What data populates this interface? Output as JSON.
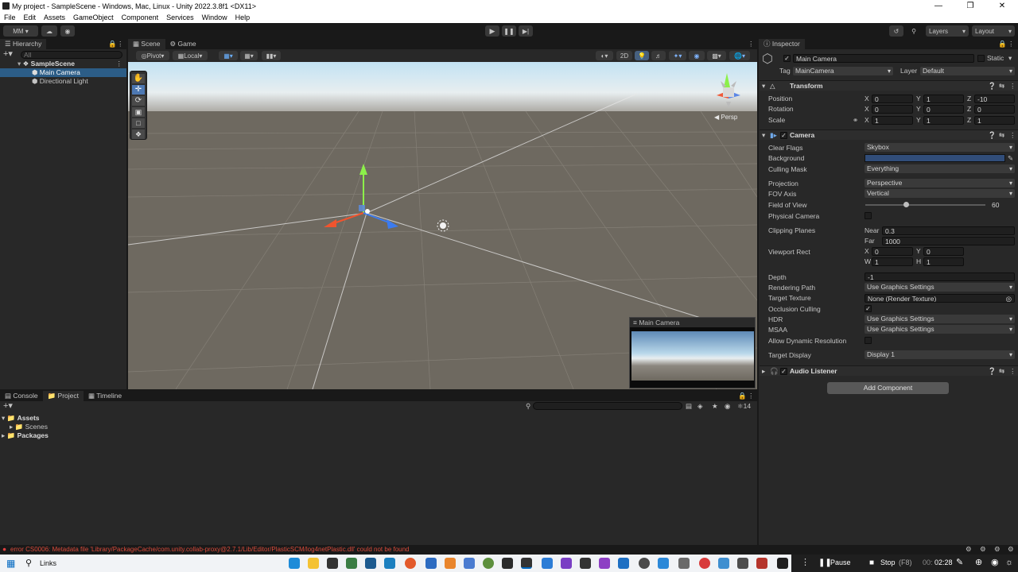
{
  "window": {
    "title": "My project - SampleScene - Windows, Mac, Linux - Unity 2022.3.8f1 <DX11>"
  },
  "menu": [
    "File",
    "Edit",
    "Assets",
    "GameObject",
    "Component",
    "Services",
    "Window",
    "Help"
  ],
  "toolbar": {
    "account": "MM",
    "layers": "Layers",
    "layout": "Layout"
  },
  "hierarchy": {
    "tab": "Hierarchy",
    "search_placeholder": "All",
    "scene": "SampleScene",
    "items": [
      "Main Camera",
      "Directional Light"
    ]
  },
  "scene_view": {
    "tabs": [
      "Scene",
      "Game"
    ],
    "pivot": "Pivot",
    "local": "Local",
    "mode2d": "2D",
    "persp": "Persp",
    "camera_preview_title": "Main Camera"
  },
  "inspector": {
    "tab": "Inspector",
    "object_name": "Main Camera",
    "static_label": "Static",
    "tag_label": "Tag",
    "tag": "MainCamera",
    "layer_label": "Layer",
    "layer": "Default",
    "transform": {
      "title": "Transform",
      "position_label": "Position",
      "position": {
        "x": "0",
        "y": "1",
        "z": "-10"
      },
      "rotation_label": "Rotation",
      "rotation": {
        "x": "0",
        "y": "0",
        "z": "0"
      },
      "scale_label": "Scale",
      "scale": {
        "x": "1",
        "y": "1",
        "z": "1"
      }
    },
    "camera": {
      "title": "Camera",
      "clear_flags_label": "Clear Flags",
      "clear_flags": "Skybox",
      "background_label": "Background",
      "background_color": "#314d79",
      "culling_mask_label": "Culling Mask",
      "culling_mask": "Everything",
      "projection_label": "Projection",
      "projection": "Perspective",
      "fov_axis_label": "FOV Axis",
      "fov_axis": "Vertical",
      "fov_label": "Field of View",
      "fov": "60",
      "physical_label": "Physical Camera",
      "clipping_label": "Clipping Planes",
      "near_label": "Near",
      "near": "0.3",
      "far_label": "Far",
      "far": "1000",
      "viewport_label": "Viewport Rect",
      "vx": "0",
      "vy": "0",
      "vw": "1",
      "vh": "1",
      "depth_label": "Depth",
      "depth": "-1",
      "rendering_path_label": "Rendering Path",
      "rendering_path": "Use Graphics Settings",
      "target_texture_label": "Target Texture",
      "target_texture": "None (Render Texture)",
      "occlusion_label": "Occlusion Culling",
      "hdr_label": "HDR",
      "hdr": "Use Graphics Settings",
      "msaa_label": "MSAA",
      "msaa": "Use Graphics Settings",
      "dynres_label": "Allow Dynamic Resolution",
      "target_display_label": "Target Display",
      "target_display": "Display 1"
    },
    "audio_listener": "Audio Listener",
    "add_component": "Add Component"
  },
  "bottom": {
    "tabs": [
      "Console",
      "Project",
      "Timeline"
    ],
    "tree": [
      "Assets",
      "Scenes",
      "Packages"
    ],
    "badge": "14"
  },
  "status": {
    "error": "error CS0006: Metadata file 'Library/PackageCache/com.unity.collab-proxy@2.7.1/Lib/Editor/PlasticSCM/log4netPlastic.dll' could not be found"
  },
  "taskbar": {
    "search": "Links",
    "pause": "Pause",
    "stop": "Stop",
    "stop_key": "(F8)",
    "time_prefix": "00:",
    "time": "02:28"
  }
}
